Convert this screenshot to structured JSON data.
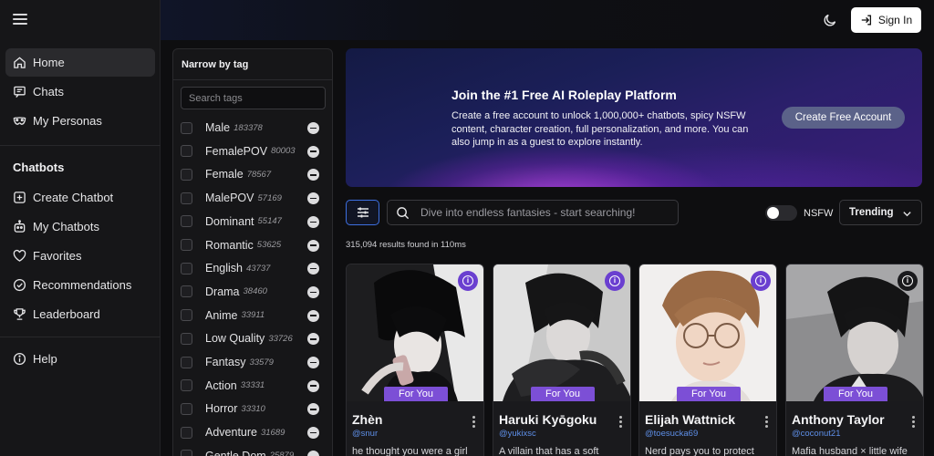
{
  "sidebar": {
    "items": [
      {
        "label": "Home",
        "icon": "home-icon"
      },
      {
        "label": "Chats",
        "icon": "chat-icon"
      },
      {
        "label": "My Personas",
        "icon": "mask-icon"
      }
    ],
    "section_title": "Chatbots",
    "chatbot_items": [
      {
        "label": "Create Chatbot",
        "icon": "plus-square-icon"
      },
      {
        "label": "My Chatbots",
        "icon": "bot-icon"
      },
      {
        "label": "Favorites",
        "icon": "heart-icon"
      },
      {
        "label": "Recommendations",
        "icon": "check-circle-icon"
      },
      {
        "label": "Leaderboard",
        "icon": "trophy-icon"
      }
    ],
    "help_label": "Help"
  },
  "header": {
    "signin_label": "Sign In"
  },
  "tags": {
    "title": "Narrow by tag",
    "search_placeholder": "Search tags",
    "items": [
      {
        "name": "Male",
        "count": "183378"
      },
      {
        "name": "FemalePOV",
        "count": "80003"
      },
      {
        "name": "Female",
        "count": "78567"
      },
      {
        "name": "MalePOV",
        "count": "57169"
      },
      {
        "name": "Dominant",
        "count": "55147"
      },
      {
        "name": "Romantic",
        "count": "53625"
      },
      {
        "name": "English",
        "count": "43737"
      },
      {
        "name": "Drama",
        "count": "38460"
      },
      {
        "name": "Anime",
        "count": "33911"
      },
      {
        "name": "Low Quality",
        "count": "33726"
      },
      {
        "name": "Fantasy",
        "count": "33579"
      },
      {
        "name": "Action",
        "count": "33331"
      },
      {
        "name": "Horror",
        "count": "33310"
      },
      {
        "name": "Adventure",
        "count": "31689"
      },
      {
        "name": "Gentle Dom",
        "count": "25879"
      }
    ]
  },
  "banner": {
    "title": "Join the #1 Free AI Roleplay Platform",
    "text": "Create a free account to unlock 1,000,000+ chatbots, spicy NSFW content, character creation, full personalization, and more. You can also jump in as a guest to explore instantly.",
    "cta": "Create Free Account"
  },
  "search": {
    "placeholder": "Dive into endless fantasies - start searching!",
    "nsfw_label": "NSFW",
    "nsfw_enabled": false,
    "sort_label": "Trending",
    "results": "315,094 results found in 110ms"
  },
  "cards": [
    {
      "name": "Zhèn",
      "handle": "@snur",
      "badge": "For You",
      "desc": "he thought you were a girl"
    },
    {
      "name": "Haruki Kyōgoku",
      "handle": "@yukixsc",
      "badge": "For You",
      "desc": "A villain that has a soft"
    },
    {
      "name": "Elijah Wattnick",
      "handle": "@toesucka69",
      "badge": "For You",
      "desc": "Nerd pays you to protect"
    },
    {
      "name": "Anthony Taylor",
      "handle": "@coconut21",
      "badge": "For You",
      "desc": "Mafia husband × little wife"
    }
  ],
  "colors": {
    "accent": "#7c4fd6",
    "link": "#5e8fe8",
    "filter_border": "#3d6fe0"
  }
}
